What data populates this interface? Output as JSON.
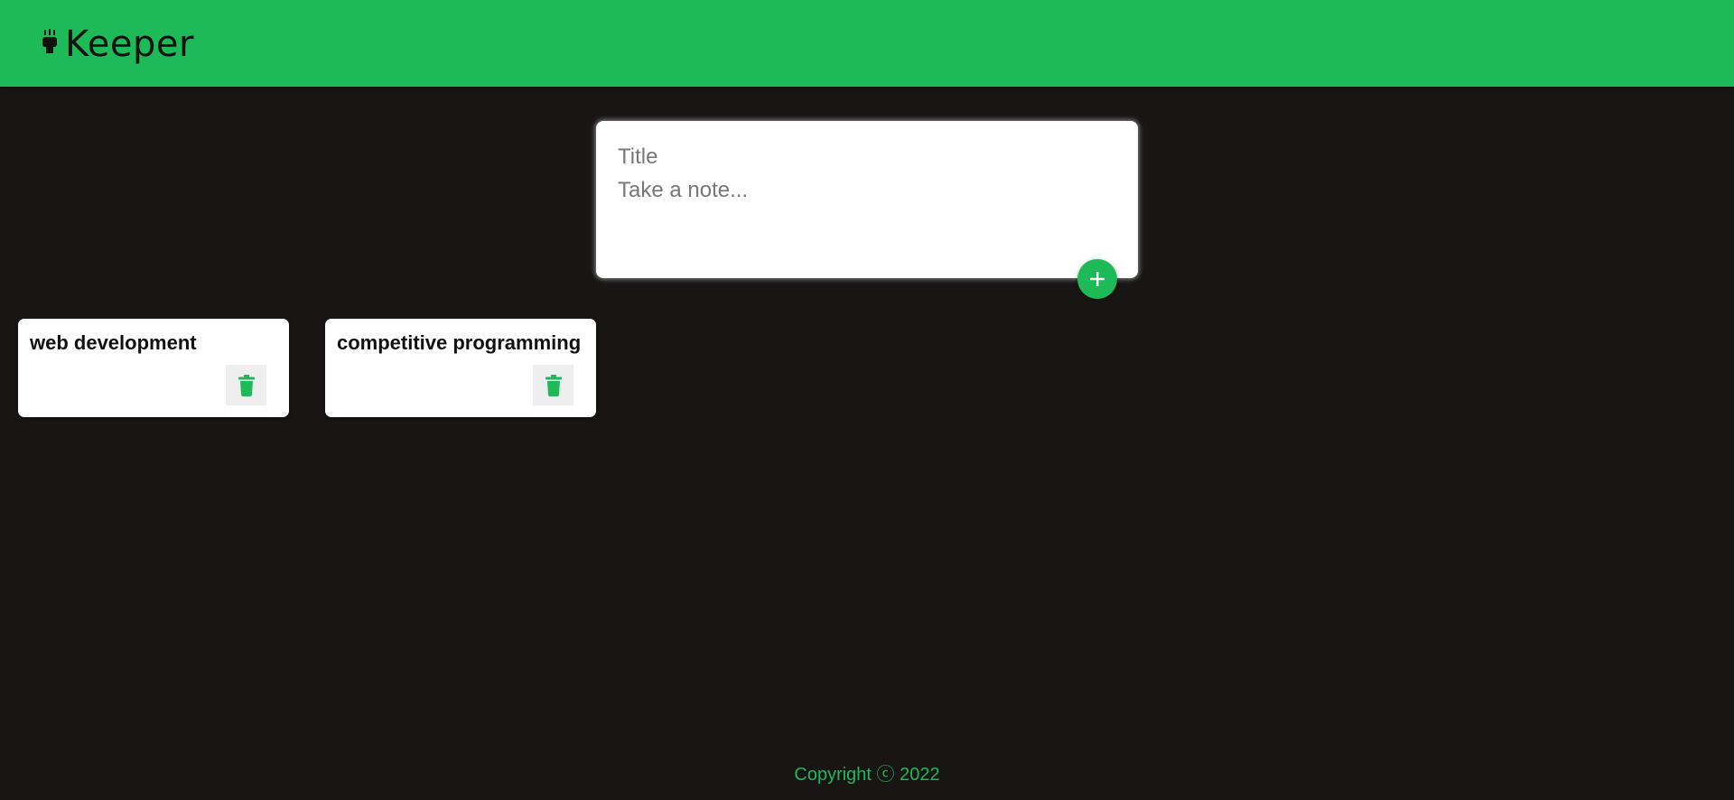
{
  "header": {
    "brand_name": "Keeper",
    "brand_icon": "lightbulb-icon"
  },
  "composer": {
    "title_placeholder": "Title",
    "content_placeholder": "Take a note...",
    "add_icon": "plus-icon"
  },
  "notes": [
    {
      "title": "web development",
      "delete_icon": "trash-icon"
    },
    {
      "title": "competitive programming",
      "delete_icon": "trash-icon"
    }
  ],
  "footer": {
    "copyright": "Copyright ⓒ 2022"
  },
  "colors": {
    "accent": "#1fba58",
    "background": "#1a1515",
    "card": "#ffffff",
    "delete_button_bg": "#eeeeee"
  }
}
